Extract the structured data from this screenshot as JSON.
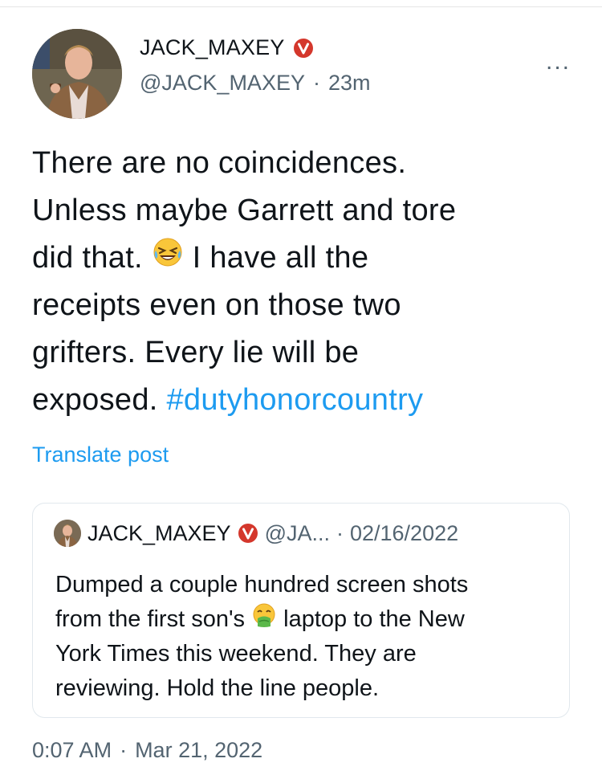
{
  "author": {
    "name": "JACK_MAXEY",
    "handle": "@JACK_MAXEY",
    "separator": "·",
    "age": "23m",
    "verified_icon": "verified-badge"
  },
  "more_menu_label": "...",
  "tweet": {
    "lines": [
      [
        "There are no coincidences."
      ],
      [
        "Unless maybe Garrett and tore"
      ],
      [
        "did that. ",
        "I have all the"
      ],
      [
        "receipts even on those two"
      ],
      [
        "grifters. Every lie will be"
      ],
      [
        "exposed. "
      ]
    ],
    "hashtag": "#dutyhonorcountry",
    "emoji": "rolling-on-floor-laughing"
  },
  "translate_label": "Translate post",
  "quoted": {
    "name": "JACK_MAXEY",
    "handle": "@JA...",
    "separator": "·",
    "date": "02/16/2022",
    "lines": [
      "Dumped a couple hundred screen shots",
      [
        "from the first son's ",
        "laptop to the New"
      ],
      "York Times this weekend. They are",
      "reviewing. Hold the line people."
    ],
    "emoji": "nauseated-face"
  },
  "footer": {
    "time": "0:07 AM",
    "separator": "·",
    "date": "Mar 21, 2022"
  },
  "colors": {
    "link": "#1d9bf0",
    "muted": "#536471",
    "text": "#0f1419",
    "verified_badge": "#d4372c"
  }
}
